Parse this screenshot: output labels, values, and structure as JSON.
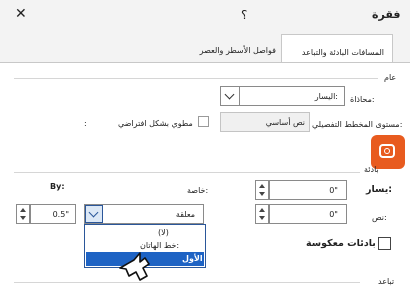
{
  "dialog": {
    "title": "فقرة",
    "help": "؟",
    "close_glyph": "✕"
  },
  "tabs": [
    {
      "label": "المسافات البادئة والتباعد",
      "active": true
    },
    {
      "label": "فواصل الأسطر والعصر",
      "active": false
    }
  ],
  "general": {
    "heading": "عام",
    "alignment_label": "محاذاة:",
    "alignment_value": "اليسار:",
    "outline_label": "مستوى المخطط التفصيلي:",
    "outline_value": "نص أساسي",
    "collapsed_label": "مطوي بشكل افتراضي"
  },
  "indent": {
    "heading": "بادئة",
    "left_label": "يسار:",
    "left_value": "0\"",
    "right_label": "نص:",
    "right_value": "0\"",
    "special_label": "خاصة:",
    "special_value": "معلقة",
    "by_label": "By:",
    "by_value": "0.5\"",
    "mirror_label": "بادئات معكوسة",
    "dropdown_options": [
      "(لا)",
      "خط الهاتان:",
      "الأول"
    ],
    "dropdown_selected_index": 2
  },
  "spacing": {
    "heading": "تباعد"
  },
  "colors": {
    "accent": "#2b579a",
    "badge": "#e85b1f",
    "selected": "#1e63c4"
  }
}
